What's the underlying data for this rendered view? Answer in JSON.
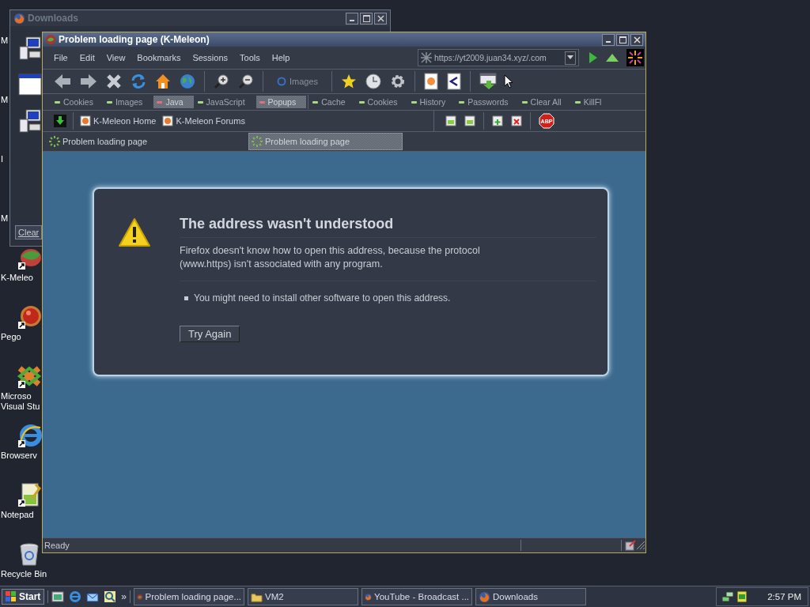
{
  "desktop_icons": [
    {
      "lines": [
        "M"
      ],
      "kind": "covered"
    },
    {
      "lines": [
        "M"
      ],
      "kind": "covered"
    },
    {
      "lines": [
        "I"
      ],
      "kind": "covered"
    },
    {
      "lines": [
        "M"
      ],
      "kind": "covered"
    },
    {
      "lines": [
        "K-Meleo"
      ],
      "kind": "kmeleon"
    },
    {
      "lines": [
        "Pego"
      ],
      "kind": "pego"
    },
    {
      "lines": [
        "Microso",
        "Visual Stu"
      ],
      "kind": "studio"
    },
    {
      "lines": [
        "Browserv"
      ],
      "kind": "ie"
    },
    {
      "lines": [
        "Notepad"
      ],
      "kind": "notepad"
    },
    {
      "lines": [
        "Recycle Bin"
      ],
      "kind": "recycle"
    }
  ],
  "downloads_window": {
    "title": "Downloads",
    "button": "Clear"
  },
  "browser": {
    "title": "Problem loading page (K-Meleon)",
    "menu": [
      "File",
      "Edit",
      "View",
      "Bookmarks",
      "Sessions",
      "Tools",
      "Help"
    ],
    "address": "https://yt2009.juan34.xyz/.com",
    "images_button": "Images",
    "privacy_bar": [
      {
        "label": "Cookies",
        "kind": "toggle",
        "on": true
      },
      {
        "label": "Images",
        "kind": "toggle",
        "on": true
      },
      {
        "label": "Java",
        "kind": "toggle",
        "on": false
      },
      {
        "label": "JavaScript",
        "kind": "toggle",
        "on": true
      },
      {
        "label": "Popups",
        "kind": "toggle",
        "on": false
      },
      {
        "label": "Cache",
        "kind": "action"
      },
      {
        "label": "Cookies",
        "kind": "action"
      },
      {
        "label": "History",
        "kind": "action"
      },
      {
        "label": "Passwords",
        "kind": "action"
      },
      {
        "label": "Clear All",
        "kind": "action"
      },
      {
        "label": "KillFl",
        "kind": "action"
      }
    ],
    "bookmarks": [
      "K-Meleon Home",
      "K-Meleon Forums"
    ],
    "adblock_badge": "ABP",
    "tabs": [
      {
        "label": "Problem loading page",
        "selected": false
      },
      {
        "label": "Problem loading page",
        "selected": true
      }
    ],
    "error": {
      "title": "The address wasn't understood",
      "message": "Firefox doesn't know how to open this address, because the protocol (www.https) isn't associated with any program.",
      "bullets": [
        "You might need to install other software to open this address."
      ],
      "button": "Try Again"
    },
    "status_bar": {
      "text": "Ready"
    }
  },
  "taskbar": {
    "start": "Start",
    "more": "»",
    "tasks": [
      {
        "label": "Problem loading page...",
        "kind": "kmeleon"
      },
      {
        "label": "VM2",
        "kind": "folder"
      },
      {
        "label": "YouTube - Broadcast ...",
        "kind": "firefox"
      },
      {
        "label": "Downloads",
        "kind": "firefox"
      }
    ],
    "clock": "2:57 PM"
  }
}
